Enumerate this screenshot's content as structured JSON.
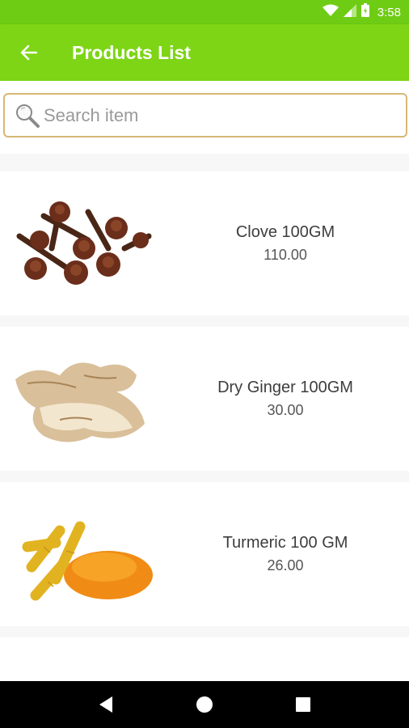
{
  "status_bar": {
    "time": "3:58"
  },
  "app_bar": {
    "title": "Products List"
  },
  "search": {
    "placeholder": "Search item"
  },
  "products": [
    {
      "name": "Clove 100GM",
      "price": "110.00"
    },
    {
      "name": "Dry Ginger 100GM",
      "price": "30.00"
    },
    {
      "name": "Turmeric 100 GM",
      "price": "26.00"
    }
  ],
  "colors": {
    "status_bar": "#6fcc14",
    "app_bar": "#7dd516",
    "search_border": "#d8b775"
  },
  "icons": [
    "wifi-icon",
    "signal-icon",
    "battery-icon",
    "back-arrow-icon",
    "search-icon",
    "nav-back-icon",
    "nav-home-icon",
    "nav-recents-icon"
  ]
}
